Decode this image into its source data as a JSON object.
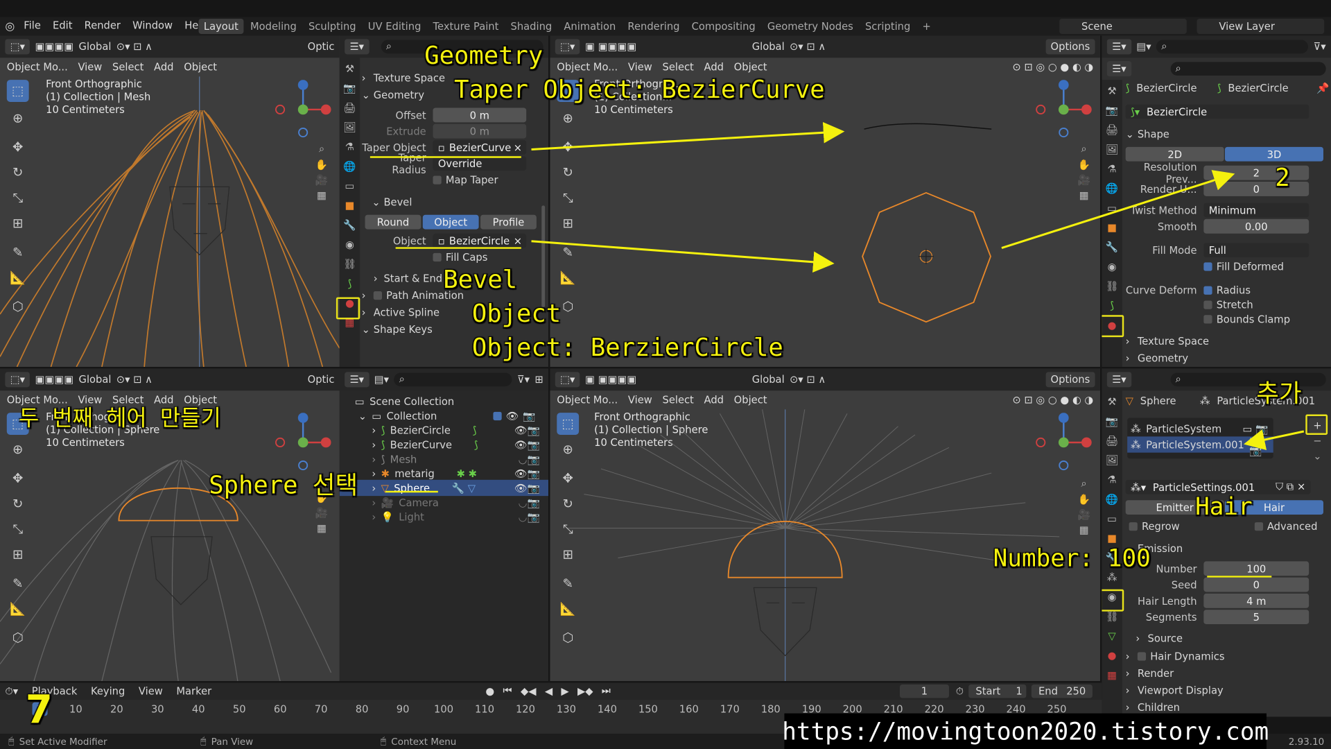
{
  "topbar": {
    "menus": [
      "File",
      "Edit",
      "Render",
      "Window",
      "Help"
    ],
    "workspaces": [
      "Layout",
      "Modeling",
      "Sculpting",
      "UV Editing",
      "Texture Paint",
      "Shading",
      "Animation",
      "Rendering",
      "Compositing",
      "Geometry Nodes",
      "Scripting"
    ],
    "active_workspace": "Layout",
    "scene": "Scene",
    "view_layer": "View Layer"
  },
  "vp_menu": {
    "mode": "Object Mo...",
    "view": "View",
    "select": "Select",
    "add": "Add",
    "object": "Object",
    "global": "Global",
    "options": "Options",
    "optic": "Optic"
  },
  "vp_tl": {
    "l1": "Front Orthographic",
    "l2": "(1) Collection | Mesh",
    "l3": "10 Centimeters"
  },
  "vp_tr": {
    "l1": "Front Orthogra...",
    "l2": "(1) Collection...",
    "l3": "10 Centimeters"
  },
  "vp_bl": {
    "l1": "Front Orthogra...",
    "l2": "(1) Collection | Sphere",
    "l3": "10 Centimeters"
  },
  "vp_br": {
    "l1": "Front Orthographic",
    "l2": "(1) Collection | Sphere",
    "l3": "10 Centimeters"
  },
  "curve_props": {
    "texture_space": "Texture Space",
    "geometry": "Geometry",
    "offset_label": "Offset",
    "offset": "0 m",
    "extrude_label": "Extrude",
    "extrude": "0 m",
    "taper_object_label": "Taper Object",
    "taper_object": "BezierCurve",
    "taper_radius_label": "Taper Radius",
    "taper_radius": "Override",
    "map_taper": "Map Taper",
    "bevel": "Bevel",
    "bevel_tabs": [
      "Round",
      "Object",
      "Profile"
    ],
    "object_label": "Object",
    "bevel_object": "BezierCircle",
    "fill_caps": "Fill Caps",
    "start_end": "Start & End M...",
    "path_animation": "Path Animation",
    "active_spline": "Active Spline",
    "shape_keys": "Shape Keys"
  },
  "circle_props": {
    "name_a": "BezierCircle",
    "name_b": "BezierCircle",
    "data_name": "BezierCircle",
    "shape": "Shape",
    "dim_2d": "2D",
    "dim_3d": "3D",
    "res_preview_label": "Resolution Prev...",
    "res_preview": "2",
    "render_label": "Render U...",
    "render": "0",
    "twist_label": "Twist Method",
    "twist": "Minimum",
    "smooth_label": "Smooth",
    "smooth": "0.00",
    "fill_mode_label": "Fill Mode",
    "fill_mode": "Full",
    "fill_deformed": "Fill Deformed",
    "curve_deform_label": "Curve Deform",
    "radius": "Radius",
    "stretch": "Stretch",
    "bounds_clamp": "Bounds Clamp",
    "texture_space": "Texture Space",
    "geometry": "Geometry"
  },
  "outliner": {
    "scene_collection": "Scene Collection",
    "collection": "Collection",
    "items": [
      "BezierCircle",
      "BezierCurve",
      "Mesh",
      "metarig",
      "Sphere",
      "Camera",
      "Light"
    ]
  },
  "particle_props": {
    "object": "Sphere",
    "system_header": "ParticleSystem.001",
    "systems": [
      "ParticleSystem",
      "ParticleSystem.001"
    ],
    "settings": "ParticleSettings.001",
    "emitter": "Emitter",
    "hair": "Hair",
    "regrow": "Regrow",
    "advanced": "Advanced",
    "emission": "Emission",
    "number_label": "Number",
    "number": "100",
    "seed_label": "Seed",
    "seed": "0",
    "hair_length_label": "Hair Length",
    "hair_length": "4 m",
    "segments_label": "Segments",
    "segments": "5",
    "source": "Source",
    "hair_dynamics": "Hair Dynamics",
    "render": "Render",
    "viewport_display": "Viewport Display",
    "children": "Children"
  },
  "timeline": {
    "playback": "Playback",
    "keying": "Keying",
    "view": "View",
    "marker": "Marker",
    "current_frame": "1",
    "start_label": "Start",
    "start": "1",
    "end_label": "End",
    "end": "250",
    "ticks": [
      "1",
      "10",
      "20",
      "30",
      "40",
      "50",
      "60",
      "70",
      "80",
      "90",
      "100",
      "110",
      "120",
      "130",
      "140",
      "150",
      "160",
      "170",
      "180",
      "190",
      "200",
      "210",
      "220",
      "230",
      "240",
      "250"
    ]
  },
  "status": {
    "left": "Set Active Modifier",
    "mid": "Pan View",
    "right": "Context Menu",
    "version": "2.93.10"
  },
  "annotations": {
    "geometry": "Geometry",
    "taper": "Taper Object: BezierCurve",
    "bevel": "Bevel",
    "object": "Object",
    "object_circle": "Object: BerzierCircle",
    "two": "2",
    "add": "추가",
    "hair": "Hair",
    "number": "Number: 100",
    "second_hair": "두 번째 헤어 만들기",
    "sphere_select": "Sphere 선택",
    "step": "7",
    "url": "https://movingtoon2020.tistory.com"
  },
  "colors": {
    "accent": "#4772b3",
    "annotation": "#f4f10e",
    "selected_orange": "#e8882a"
  }
}
